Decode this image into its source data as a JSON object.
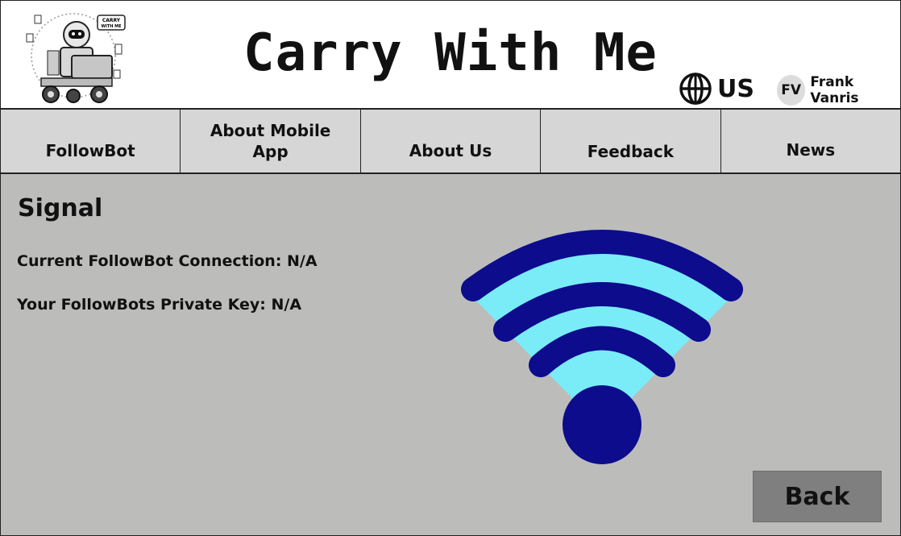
{
  "header": {
    "title": "Carry With Me",
    "logo_badge_line1": "CARRY",
    "logo_badge_line2": "WITH ME",
    "locale": "US",
    "user_initials": "FV",
    "user_name": "Frank Vanris"
  },
  "nav": {
    "items": [
      {
        "label": "FollowBot"
      },
      {
        "label": "About Mobile App"
      },
      {
        "label": "About Us"
      },
      {
        "label": "Feedback"
      },
      {
        "label": "News"
      }
    ]
  },
  "main": {
    "title": "Signal",
    "connection_text": "Current FollowBot Connection: N/A",
    "key_text": "Your FollowBots Private Key: N/A"
  },
  "actions": {
    "back_label": "Back"
  },
  "icons": {
    "locale": "globe-icon",
    "signal": "wifi-signal-icon",
    "logo": "robot-logo-icon"
  },
  "colors": {
    "page_bg": "#bcbdbb",
    "nav_bg": "#d6d6d6",
    "wifi_dark": "#0c0c8c",
    "wifi_light": "#7aecf8",
    "back_button_bg": "#7f7f7f"
  }
}
